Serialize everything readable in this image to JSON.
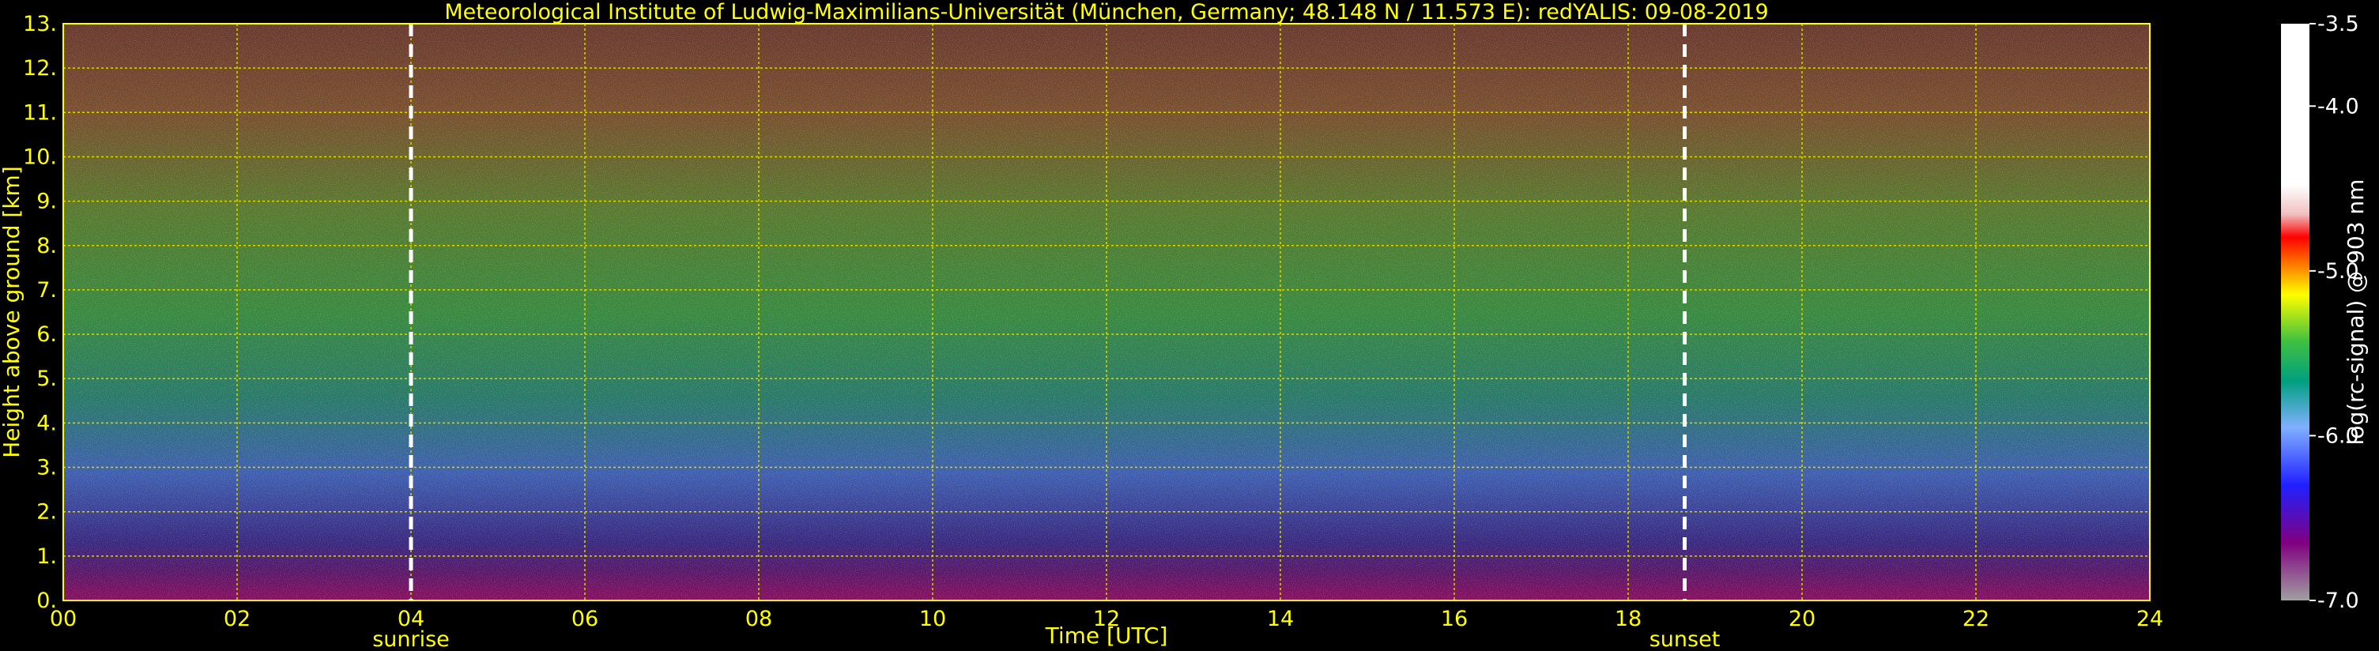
{
  "title": "Meteorological Institute of Ludwig-Maximilians-Universität (München, Germany; 48.148 N / 11.573 E):    redYALIS: 09-08-2019",
  "colors": {
    "axis_text": "#ffff00",
    "grid": "#d8d800",
    "event_line": "#ffffff",
    "colorbar_text": "#ffffff"
  },
  "chart_data": {
    "type": "heatmap",
    "title": "Meteorological Institute of Ludwig-Maximilians-Universität (München, Germany; 48.148 N / 11.573 E):    redYALIS: 09-08-2019",
    "xlabel": "Time [UTC]",
    "ylabel": "Height above ground [km]",
    "xlim": [
      0,
      24
    ],
    "ylim": [
      0,
      13
    ],
    "x_ticks": [
      "00",
      "02",
      "04",
      "06",
      "08",
      "10",
      "12",
      "14",
      "16",
      "18",
      "20",
      "22",
      "24"
    ],
    "y_ticks": [
      "0.",
      "1.",
      "2.",
      "3.",
      "4.",
      "5.",
      "6.",
      "7.",
      "8.",
      "9.",
      "10.",
      "11.",
      "12.",
      "13."
    ],
    "grid": true,
    "events": [
      {
        "label": "sunrise",
        "time": 4.0
      },
      {
        "label": "sunset",
        "time": 18.65
      }
    ],
    "colorbar": {
      "label": "log(rc-signal) @ 903 nm",
      "range": [
        -7.0,
        -3.5
      ],
      "ticks": [
        "-3.5",
        "-4.0",
        "-5.0",
        "-6.0",
        "-7.0"
      ],
      "tick_values": [
        -3.5,
        -4.0,
        -5.0,
        -6.0,
        -7.0
      ]
    }
  }
}
